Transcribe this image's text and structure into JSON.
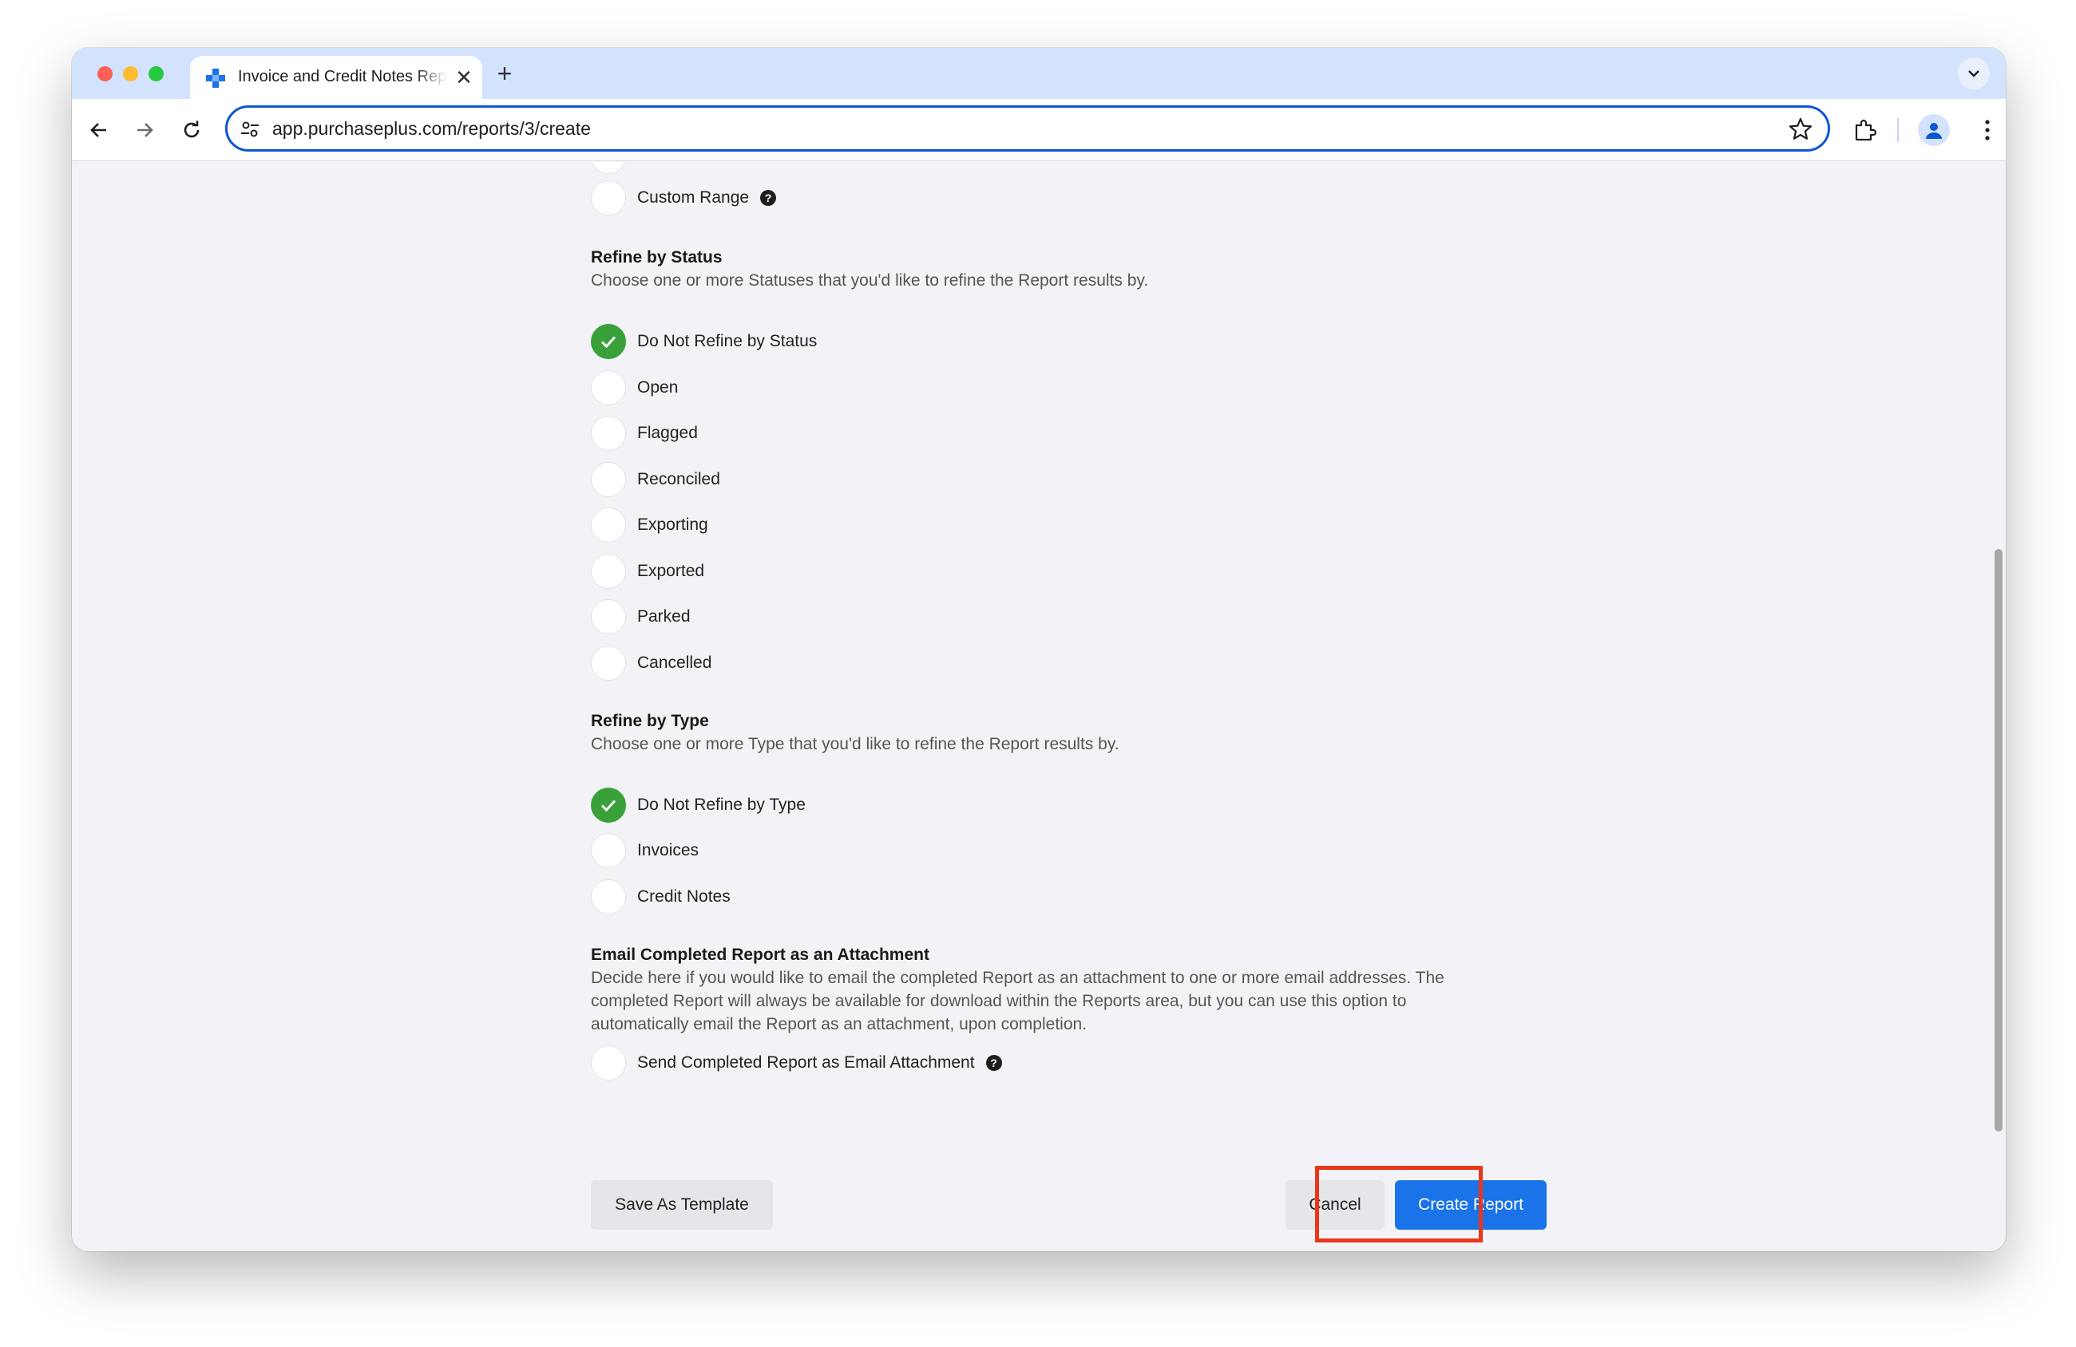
{
  "browser": {
    "tab_title": "Invoice and Credit Notes Report",
    "url": "app.purchaseplus.com/reports/3/create",
    "new_tab_symbol": "+",
    "close_symbol": "✕"
  },
  "form": {
    "date_range": {
      "options": [
        {
          "label": "Custom Range",
          "checked": false,
          "help": "?"
        }
      ]
    },
    "status": {
      "title": "Refine by Status",
      "description": "Choose one or more Statuses that you'd like to refine the Report results by.",
      "options": [
        {
          "label": "Do Not Refine by Status",
          "checked": true
        },
        {
          "label": "Open",
          "checked": false
        },
        {
          "label": "Flagged",
          "checked": false
        },
        {
          "label": "Reconciled",
          "checked": false
        },
        {
          "label": "Exporting",
          "checked": false
        },
        {
          "label": "Exported",
          "checked": false
        },
        {
          "label": "Parked",
          "checked": false
        },
        {
          "label": "Cancelled",
          "checked": false
        }
      ]
    },
    "type": {
      "title": "Refine by Type",
      "description": "Choose one or more Type that you'd like to refine the Report results by.",
      "options": [
        {
          "label": "Do Not Refine by Type",
          "checked": true
        },
        {
          "label": "Invoices",
          "checked": false
        },
        {
          "label": "Credit Notes",
          "checked": false
        }
      ]
    },
    "email": {
      "title": "Email Completed Report as an Attachment",
      "description": "Decide here if you would like to email the completed Report as an attachment to one or more email addresses. The completed Report will always be available for download within the Reports area, but you can use this option to automatically email the Report as an attachment, upon completion.",
      "option": {
        "label": "Send Completed Report as Email Attachment",
        "checked": false,
        "help": "?"
      }
    },
    "buttons": {
      "save_template": "Save As Template",
      "cancel": "Cancel",
      "create": "Create Report"
    }
  },
  "colors": {
    "accent": "#1a73e8",
    "checked": "#3aa13a",
    "highlight": "#e8371a"
  }
}
